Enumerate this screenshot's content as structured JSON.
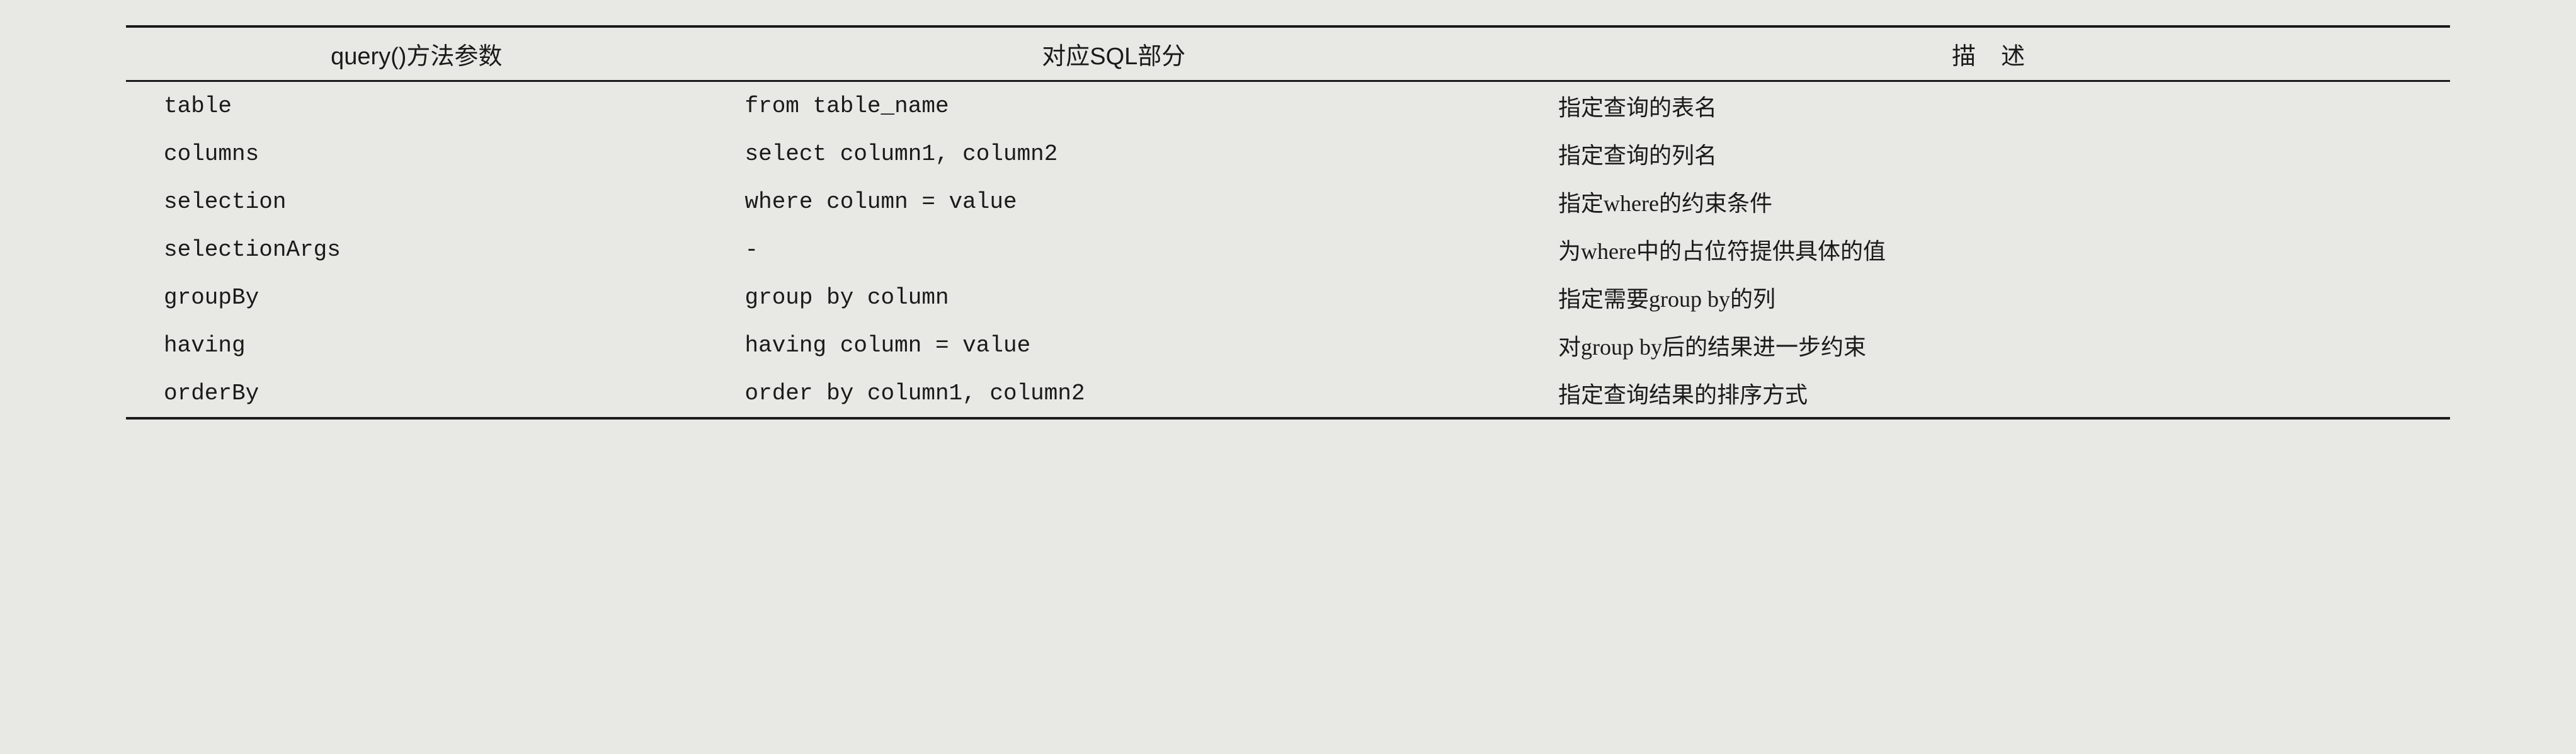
{
  "chart_data": {
    "type": "table",
    "headers": [
      "query()方法参数",
      "对应SQL部分",
      "描述"
    ],
    "rows": [
      {
        "param": "table",
        "sql": "from table_name",
        "desc": "指定查询的表名"
      },
      {
        "param": "columns",
        "sql": "select column1, column2",
        "desc": "指定查询的列名"
      },
      {
        "param": "selection",
        "sql": "where column = value",
        "desc": "指定where的约束条件"
      },
      {
        "param": "selectionArgs",
        "sql": "-",
        "desc": "为where中的占位符提供具体的值"
      },
      {
        "param": "groupBy",
        "sql": "group by column",
        "desc": "指定需要group by的列"
      },
      {
        "param": "having",
        "sql": "having column = value",
        "desc": "对group by后的结果进一步约束"
      },
      {
        "param": "orderBy",
        "sql": "order by column1, column2",
        "desc": "指定查询结果的排序方式"
      }
    ]
  }
}
